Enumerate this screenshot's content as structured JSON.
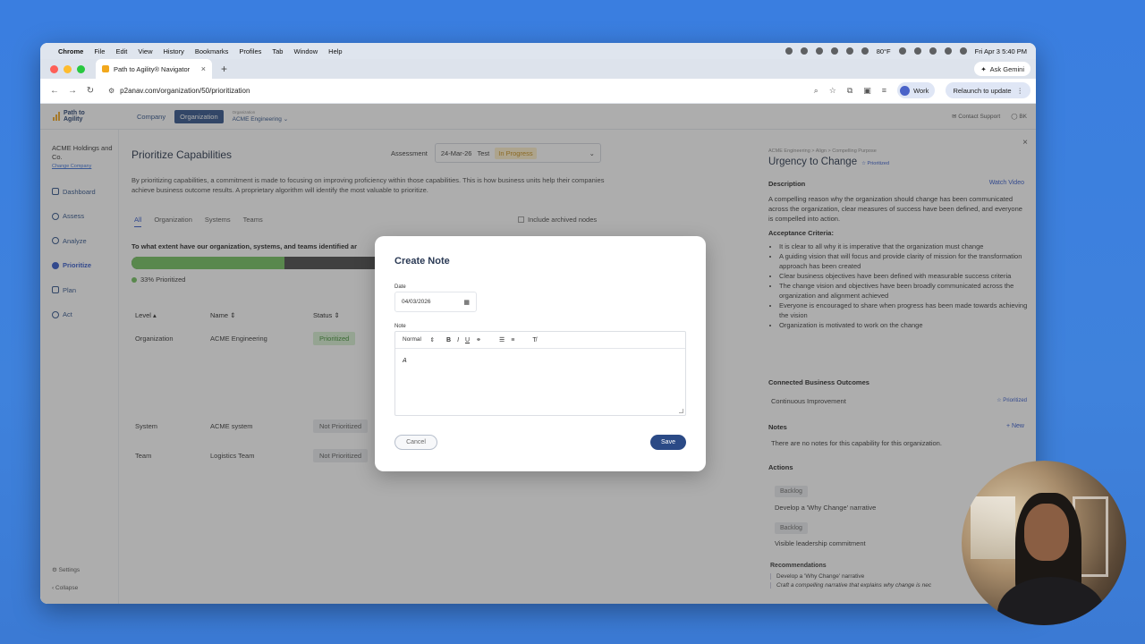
{
  "menubar": {
    "app": "Chrome",
    "items": [
      "File",
      "Edit",
      "View",
      "History",
      "Bookmarks",
      "Profiles",
      "Tab",
      "Window",
      "Help"
    ],
    "clock": "Fri Apr 3  5:40 PM",
    "weather": "80°F"
  },
  "browser": {
    "tab_title": "Path to Agility® Navigator",
    "url": "p2anav.com/organization/50/prioritization",
    "gemini": "Ask Gemini",
    "profile": "Work",
    "relaunch": "Relaunch to update"
  },
  "app": {
    "logo": [
      "Path to",
      "Agility"
    ],
    "tabs": [
      "Company",
      "Organization"
    ],
    "org_small": "Organization",
    "org_name": "ACME Engineering",
    "contact": "Contact Support",
    "user": "BK",
    "company": "ACME Holdings and Co.",
    "change_company": "Change Company",
    "nav": [
      "Dashboard",
      "Assess",
      "Analyze",
      "Prioritize",
      "Plan",
      "Act"
    ],
    "settings": "Settings",
    "collapse": "Collapse"
  },
  "main": {
    "title": "Prioritize Capabilities",
    "assessment_label": "Assessment",
    "assessment_date": "24-Mar-26",
    "assessment_name": "Test",
    "assessment_status": "In Progress",
    "description": "By prioritizing capabilities, a commitment is made to focusing on improving proficiency within those capabilities. This is how business units help their companies achieve business outcome results. A proprietary algorithm will identify the most valuable to prioritize.",
    "subtabs": [
      "All",
      "Organization",
      "Systems",
      "Teams"
    ],
    "archived": "Include archived nodes",
    "question": "To what extent have our organization, systems, and teams identified ar",
    "progress": 0.57,
    "progress_label": "33% Prioritized",
    "headers": [
      "Level",
      "Name",
      "Status"
    ],
    "rows": [
      {
        "level": "Organization",
        "name": "ACME Engineering",
        "status": "Prioritized"
      },
      {
        "level": "System",
        "name": "ACME system",
        "status": "Not Prioritized"
      },
      {
        "level": "Team",
        "name": "Logistics Team",
        "status": "Not Prioritized"
      }
    ]
  },
  "panel": {
    "crumb": "ACME Engineering > Align > Compelling Purpose",
    "title": "Urgency to Change",
    "title_badge": "☆ Prioritized",
    "desc_h": "Description",
    "watch": "Watch Video",
    "desc": "A compelling reason why the organization should change has been communicated across the organization, clear measures of success have been defined, and everyone is compelled into action.",
    "criteria_h": "Acceptance Criteria:",
    "criteria": [
      "It is clear to all why it is imperative that the organization must change",
      "A guiding vision that will focus and provide clarity of mission for the transformation approach has been created",
      "Clear business objectives have been defined with measurable success criteria",
      "The change vision and objectives have been broadly communicated across the organization and alignment achieved",
      "Everyone is encouraged to share when progress has been made towards achieving the vision",
      "Organization is motivated to work on the change"
    ],
    "outcomes_h": "Connected Business Outcomes",
    "outcome": "Continuous Improvement",
    "outcome_status": "☆ Prioritized",
    "notes_h": "Notes",
    "new_note": "+ New",
    "notes_empty": "There are no notes for this capability for this organization.",
    "actions_h": "Actions",
    "actions": [
      {
        "status": "Backlog",
        "text": "Develop a 'Why Change' narrative"
      },
      {
        "status": "Backlog",
        "text": "Visible leadership commitment"
      }
    ],
    "recs_h": "Recommendations",
    "rec1": "Develop a 'Why Change' narrative",
    "rec2": "Craft a compelling narrative that explains why change is nec"
  },
  "modal": {
    "title": "Create Note",
    "date_label": "Date",
    "date_value": "04/03/2026",
    "note_label": "Note",
    "format": "Normal",
    "note_text": "A",
    "cancel": "Cancel",
    "save": "Save"
  }
}
